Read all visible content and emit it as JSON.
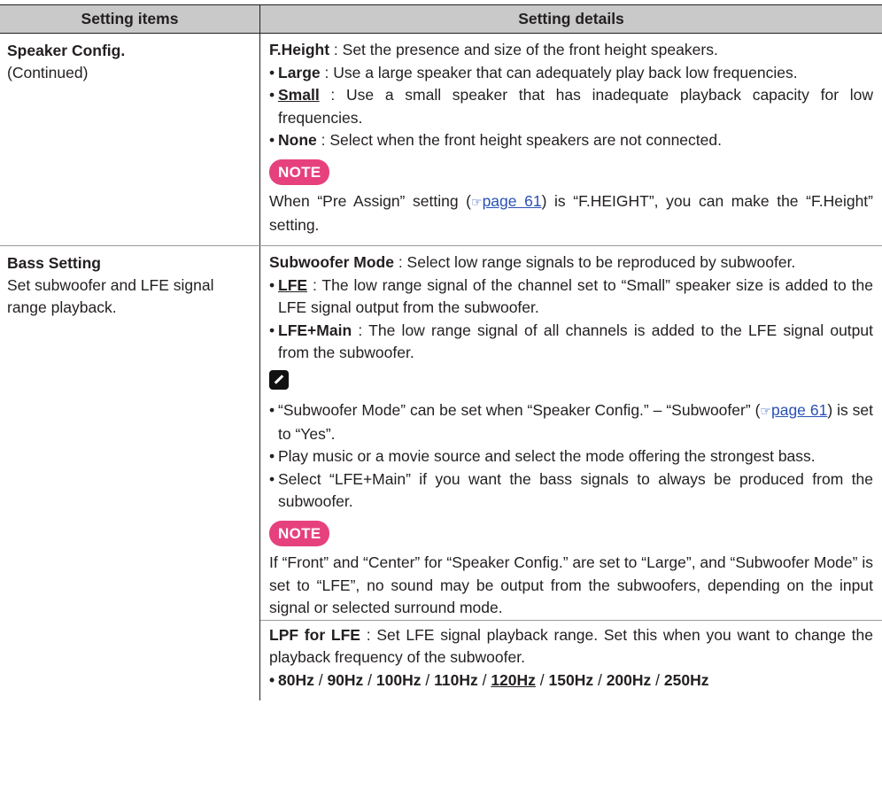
{
  "header": {
    "col1": "Setting items",
    "col2": "Setting details"
  },
  "rows": [
    {
      "title": "Speaker Config.",
      "subtitle": "(Continued)",
      "f_height": {
        "label": "F.Height",
        "desc": " : Set the presence and size of the front height speakers.",
        "bullets": [
          {
            "label": "Large",
            "desc": " : Use a large speaker that can adequately play back low frequencies."
          },
          {
            "label": "Small",
            "desc": " : Use a small speaker that has inadequate playback capacity for low frequencies."
          },
          {
            "label": "None",
            "desc": " : Select when the front height speakers are not connected."
          }
        ]
      },
      "note_label": "NOTE",
      "note_pre": "When “Pre Assign” setting (",
      "note_link": "page 61",
      "note_post": ") is “F.HEIGHT”, you can make the “F.Height” setting."
    },
    {
      "title": "Bass Setting",
      "subtitle": "Set subwoofer and LFE signal range playback.",
      "subwoofer_mode": {
        "label": "Subwoofer Mode",
        "desc": " : Select low range signals to be reproduced by subwoofer.",
        "bullets": [
          {
            "label": "LFE",
            "desc": " : The low range signal of the channel set to “Small” speaker size is added to the LFE signal output from the subwoofer."
          },
          {
            "label": "LFE+Main",
            "desc": " : The low range signal of all channels is added to the LFE signal output from the subwoofer."
          }
        ]
      },
      "tips": {
        "t1_pre": "“Subwoofer Mode” can be set when “Speaker Config.” – “Subwoofer” (",
        "t1_link": "page 61",
        "t1_post": ") is set to “Yes”.",
        "t2": "Play music or a movie source and select the mode offering the strongest bass.",
        "t3": "Select “LFE+Main” if you want the bass signals to always be produced from the subwoofer."
      },
      "note_label": "NOTE",
      "note_text": "If “Front” and “Center” for “Speaker Config.” are set to “Large”, and “Subwoofer Mode” is set to “LFE”, no sound may be output from the subwoofers, depending on the input signal or selected surround mode.",
      "lpf": {
        "label": "LPF for LFE",
        "desc": " : Set LFE signal playback range. Set this when you want to change the playback frequency of the subwoofer.",
        "options": [
          "80Hz",
          "90Hz",
          "100Hz",
          "110Hz",
          "120Hz",
          "150Hz",
          "200Hz",
          "250Hz"
        ],
        "sep": " / "
      }
    }
  ],
  "icons": {
    "page_ref": "page-reference-icon",
    "tip": "pencil-icon"
  }
}
